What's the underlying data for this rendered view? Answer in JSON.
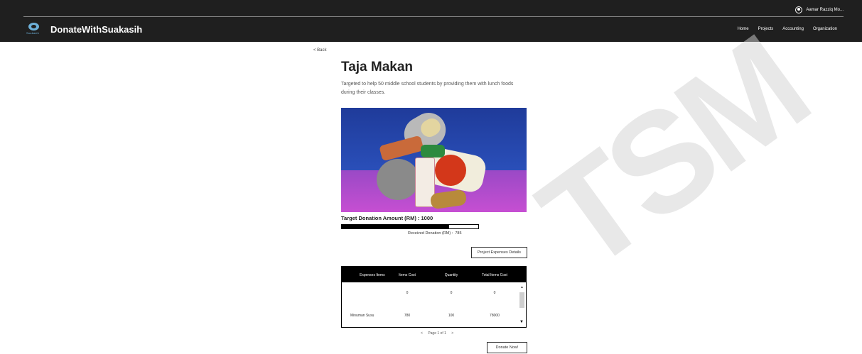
{
  "header": {
    "brand_name": "DonateWithSuakasih",
    "logo_text": "Suakasih",
    "user_name": "Aamar Razziq Mo...",
    "nav": [
      "Home",
      "Projects",
      "Accounting",
      "Organization"
    ]
  },
  "page": {
    "back_label": "< Back",
    "title": "Taja Makan",
    "description": "Targeted to help 50 middle school students by providing them with lunch foods during their classes.",
    "target_label": "Target Donation Amount (RM) :",
    "target_value": "1000",
    "received_label": "Received Donation (RM) :",
    "received_value": "785",
    "progress_fraction": 0.785,
    "expenses_button": "Project Expenses Details",
    "donate_button": "Donate Now!"
  },
  "table": {
    "headers": [
      "Expenses Items",
      "Items Cost",
      "Quantity",
      "Total Items Cost"
    ],
    "rows": [
      [
        "",
        "0",
        "0",
        "0"
      ],
      [
        "Minuman Susu",
        "780",
        "100",
        "78000"
      ]
    ],
    "pager": {
      "prev": "<",
      "label": "Page 1 of 1",
      "next": ">"
    }
  },
  "watermark": "TSM",
  "colors": {
    "header_bg": "#1f1f1f",
    "logo_accent": "#6db0d8",
    "image_wall": "#2a4fb9",
    "image_floor": "#b04bcf"
  }
}
